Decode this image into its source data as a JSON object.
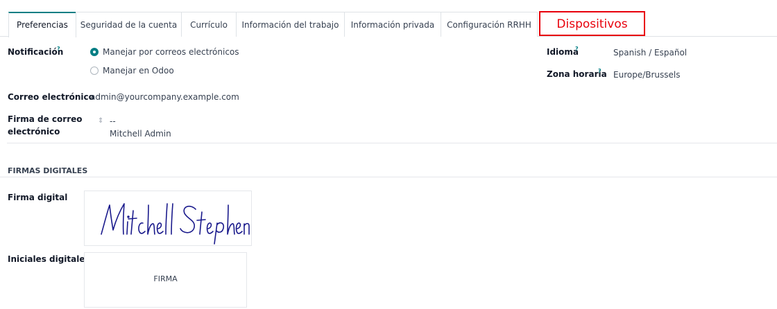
{
  "tabs": [
    {
      "label": "Preferencias"
    },
    {
      "label": "Seguridad de la cuenta"
    },
    {
      "label": "Currículo"
    },
    {
      "label": "Información del trabajo"
    },
    {
      "label": "Información privada"
    },
    {
      "label": "Configuración RRHH"
    },
    {
      "label": "Dispositivos"
    }
  ],
  "form": {
    "notification_label": "Notificación",
    "help_mark": "?",
    "notification_options": [
      "Manejar por correos electrónicos",
      "Manejar en Odoo"
    ],
    "email_label": "Correo electrónico",
    "email_value": "admin@yourcompany.example.com",
    "signature_label_line1": "Firma de correo",
    "signature_label_line2": "electrónico",
    "signature_line1": "--",
    "signature_line2": "Mitchell Admin",
    "language_label": "Idioma",
    "language_value": "Spanish / Español",
    "timezone_label": "Zona horaria",
    "timezone_value": "Europe/Brussels"
  },
  "digital": {
    "section_title": "FIRMAS DIGITALES",
    "signature_label": "Firma digital",
    "signature_image_text": "Mitchell Stephen",
    "initials_label": "Iniciales digitales",
    "initials_text": "FIRMA"
  },
  "colors": {
    "accent": "#017e84",
    "highlight": "#e8000b",
    "signature_ink": "#1a1a8c"
  }
}
